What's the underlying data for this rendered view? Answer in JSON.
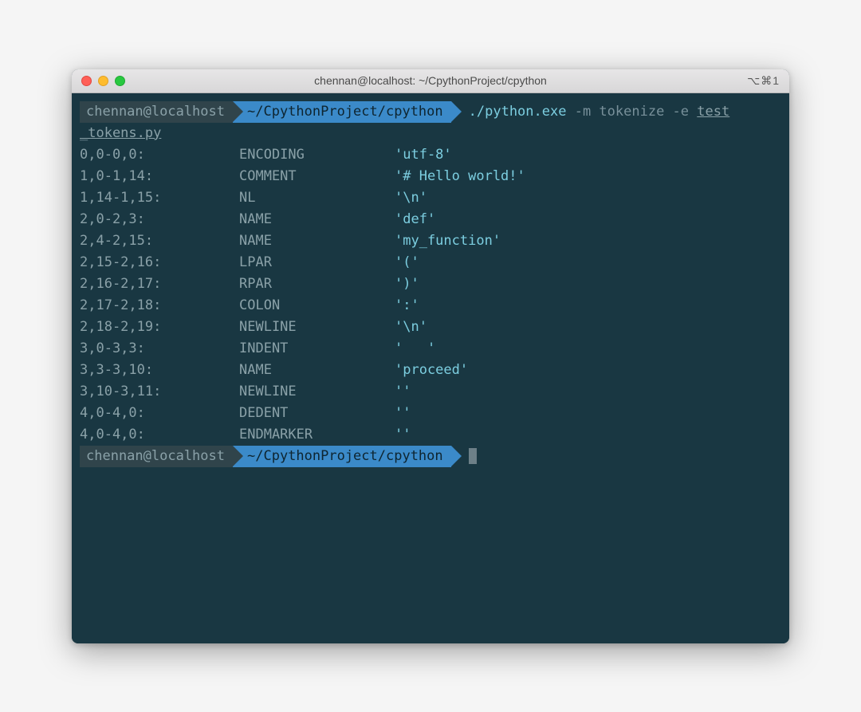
{
  "window": {
    "title": "chennan@localhost: ~/CpythonProject/cpython",
    "shortcut": "⌥⌘1"
  },
  "prompt1": {
    "host": "chennan@localhost",
    "path": "~/CpythonProject/cpython",
    "cmd_exe": "./python.exe",
    "cmd_flags": "-m tokenize -e",
    "cmd_arg": "test",
    "cmd_arg_wrap": "_tokens.py"
  },
  "tokens": [
    {
      "pos": "0,0-0,0:",
      "type": "ENCODING",
      "val": "'utf-8'"
    },
    {
      "pos": "1,0-1,14:",
      "type": "COMMENT",
      "val": "'# Hello world!'"
    },
    {
      "pos": "1,14-1,15:",
      "type": "NL",
      "val": "'\\n'"
    },
    {
      "pos": "2,0-2,3:",
      "type": "NAME",
      "val": "'def'"
    },
    {
      "pos": "2,4-2,15:",
      "type": "NAME",
      "val": "'my_function'"
    },
    {
      "pos": "2,15-2,16:",
      "type": "LPAR",
      "val": "'('"
    },
    {
      "pos": "2,16-2,17:",
      "type": "RPAR",
      "val": "')'"
    },
    {
      "pos": "2,17-2,18:",
      "type": "COLON",
      "val": "':'"
    },
    {
      "pos": "2,18-2,19:",
      "type": "NEWLINE",
      "val": "'\\n'"
    },
    {
      "pos": "3,0-3,3:",
      "type": "INDENT",
      "val": "'   '"
    },
    {
      "pos": "3,3-3,10:",
      "type": "NAME",
      "val": "'proceed'"
    },
    {
      "pos": "3,10-3,11:",
      "type": "NEWLINE",
      "val": "''"
    },
    {
      "pos": "4,0-4,0:",
      "type": "DEDENT",
      "val": "''"
    },
    {
      "pos": "4,0-4,0:",
      "type": "ENDMARKER",
      "val": "''"
    }
  ],
  "prompt2": {
    "host": "chennan@localhost",
    "path": "~/CpythonProject/cpython"
  }
}
